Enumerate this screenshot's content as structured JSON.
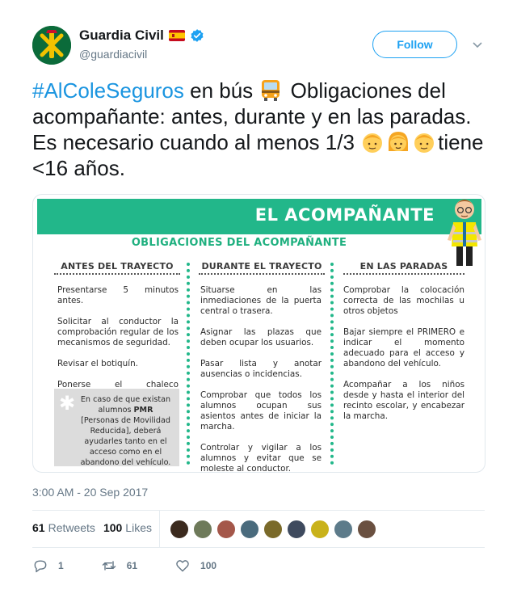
{
  "account": {
    "display_name": "Guardia Civil",
    "handle": "@guardiacivil",
    "avatar_icon": "guardia-civil-emblem",
    "flag_icon": "spain-flag",
    "verified_icon": "verified-badge-icon"
  },
  "follow_label": "Follow",
  "tweet": {
    "hashtag": "#AlColeSeguros",
    "text_1": " en bús ",
    "text_2": " Obligaciones del acompañante: antes, durante y en las paradas. Es necesario cuando al menos 1/3 ",
    "text_3": "tiene <16 años."
  },
  "infographic": {
    "title": "EL ACOMPAÑANTE",
    "subtitle": "OBLIGACIONES DEL ACOMPAÑANTE",
    "columns": [
      {
        "heading": "ANTES DEL TRAYECTO",
        "items": [
          "Presentarse 5 minutos antes.",
          "Solicitar al conductor la comprobación regular de los mecanismos de seguridad.",
          "Revisar el botiquín.",
          "Ponerse el chaleco reflectante."
        ]
      },
      {
        "heading": "DURANTE EL TRAYECTO",
        "items": [
          "Situarse en las inmediaciones de la puerta central o trasera.",
          "Asignar las plazas que deben ocupar los usuarios.",
          "Pasar lista y anotar ausencias o incidencias.",
          "Comprobar que todos los alumnos ocupan sus asientos antes de iniciar la marcha.",
          "Controlar y vigilar a los alumnos y evitar que se moleste al conductor."
        ]
      },
      {
        "heading": "EN LAS PARADAS",
        "items": [
          "Comprobar la colocación correcta de las mochilas u otros objetos",
          "Bajar siempre el PRIMERO e indicar el momento adecuado para el acceso y abandono del vehículo.",
          "Acompañar a los niños desde y hasta el interior del recinto escolar, y encabezar la marcha."
        ]
      }
    ],
    "note": {
      "before": "En caso de que existan alumnos ",
      "bold": "PMR",
      "paren": " [Personas de Movilidad Reducida],",
      "after": " deberá ayudarles tanto en el acceso como en el abandono del vehículo."
    }
  },
  "timestamp": "3:00 AM - 20 Sep 2017",
  "stats": {
    "retweets_count": "61",
    "retweets_label": "Retweets",
    "likes_count": "100",
    "likes_label": "Likes"
  },
  "liker_colors": [
    "#3b2a1e",
    "#6e7a5a",
    "#a4574a",
    "#4a6b7d",
    "#7a6a2a",
    "#3e4a5e",
    "#c9b21a",
    "#5d7b8a",
    "#6a5040"
  ],
  "actions": {
    "reply_count": "1",
    "retweet_count": "61",
    "like_count": "100"
  }
}
